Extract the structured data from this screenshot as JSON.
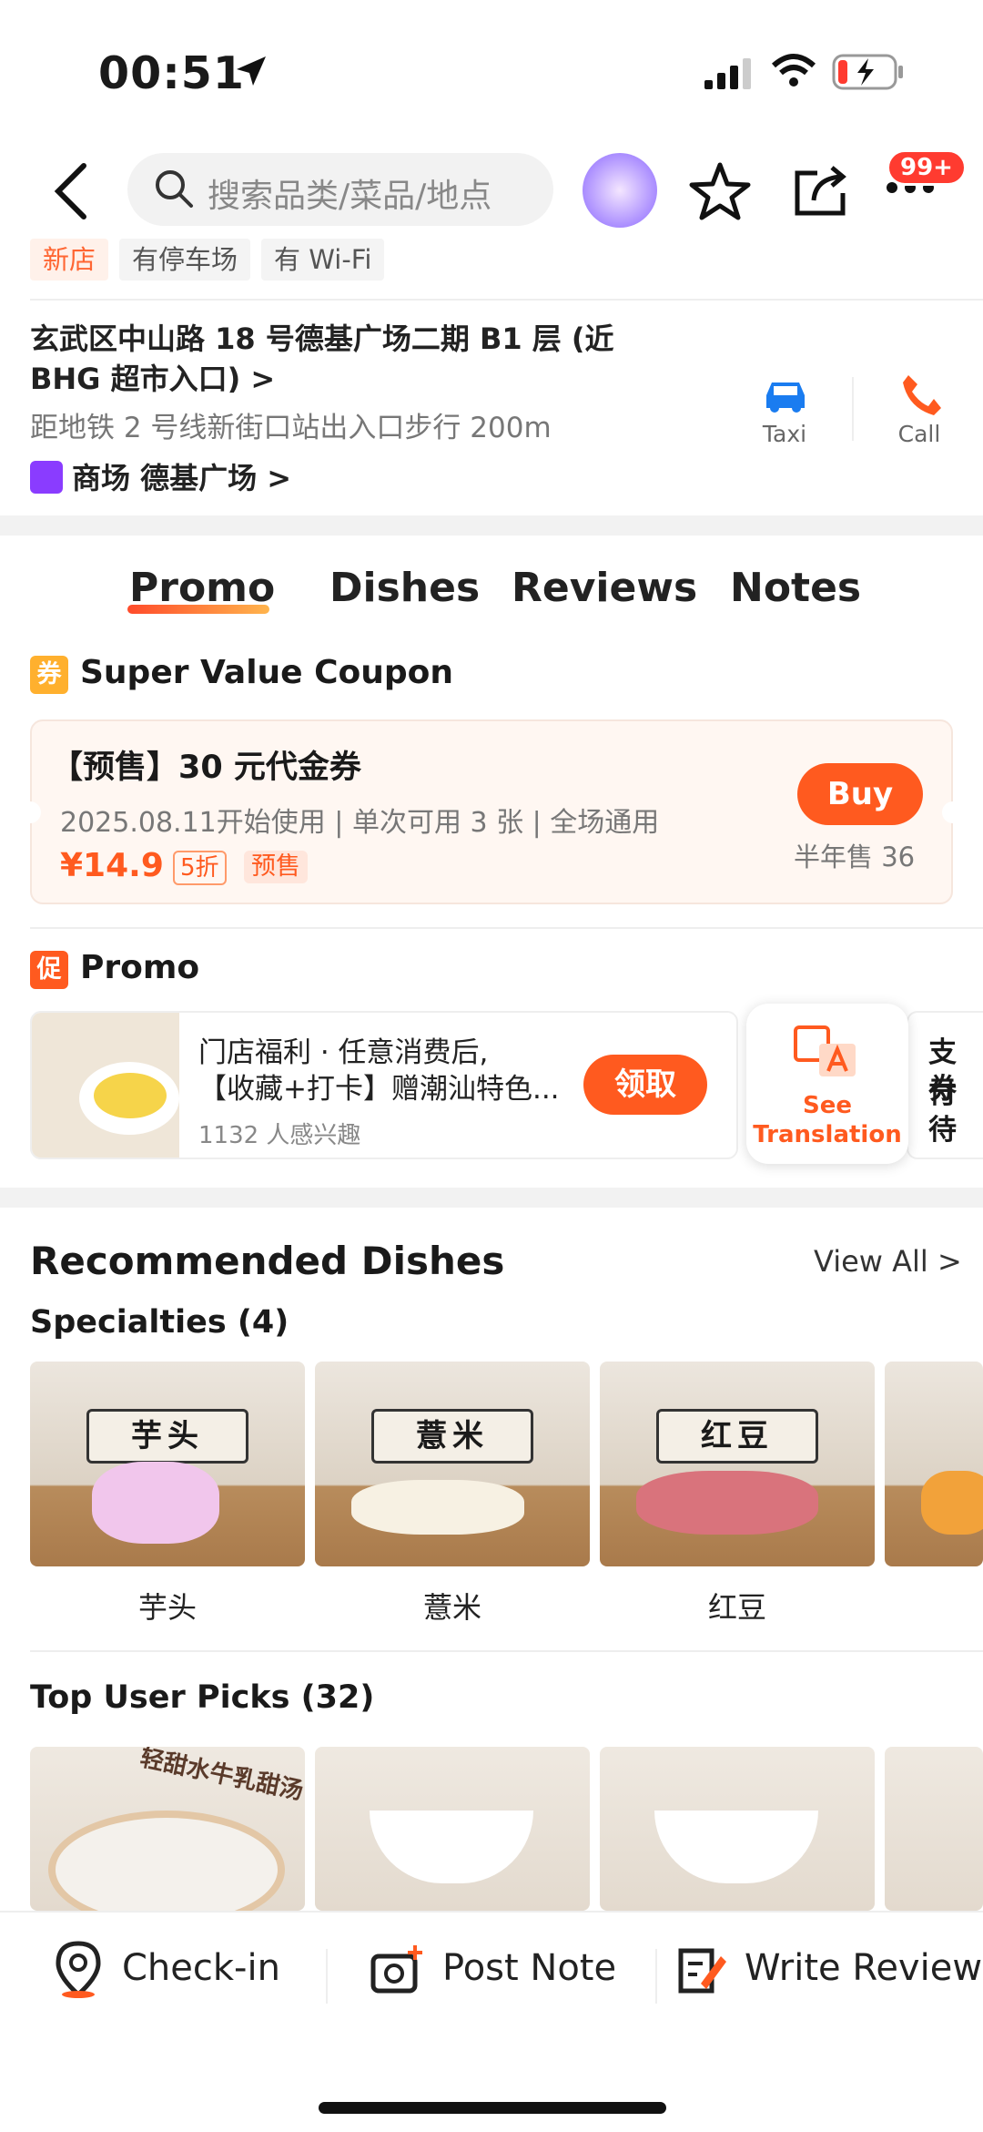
{
  "status": {
    "time": "00:51"
  },
  "nav": {
    "search_placeholder": "搜索品类/菜品/地点",
    "badge": "99+"
  },
  "tags": [
    "新店",
    "有停车场",
    "有 Wi-Fi"
  ],
  "address": {
    "line": "玄武区中山路 18 号德基广场二期 B1 层 (近 BHG 超市入口) >",
    "subway": "距地铁 2 号线新街口站出入口步行 200m",
    "mall": "商场 德基广场 >"
  },
  "actions": {
    "taxi": "Taxi",
    "call": "Call"
  },
  "tabs": [
    "Promo",
    "Dishes",
    "Reviews",
    "Notes"
  ],
  "coupon_section": {
    "icon": "券",
    "title": "Super Value Coupon",
    "name": "【预售】30 元代金券",
    "details": "2025.08.11开始使用 | 单次可用 3 张 | 全场通用",
    "price": "¥14.9",
    "discount": "5折",
    "presale": "预售",
    "buy": "Buy",
    "sold": "半年售 36"
  },
  "promo_section": {
    "icon": "促",
    "title": "Promo",
    "line1": "门店福利 · 任意消费后,",
    "line2": "【收藏+打卡】赠潮汕特色...",
    "interest": "1132 人感兴趣",
    "claim": "领取",
    "translate": "See Translation",
    "next_line1": "支付",
    "next_line2": "券待"
  },
  "recommended": {
    "title": "Recommended Dishes",
    "view_all": "View All >",
    "specialties": "Specialties (4)",
    "dishes": [
      "芋头",
      "薏米",
      "红豆"
    ],
    "top_picks": "Top User Picks (32)",
    "pick_caption": "轻甜水牛乳甜汤"
  },
  "bottom": {
    "checkin": "Check-in",
    "post": "Post Note",
    "review": "Write Review"
  },
  "colors": {
    "accent": "#ff5a1f",
    "badge": "#ff3b30"
  }
}
